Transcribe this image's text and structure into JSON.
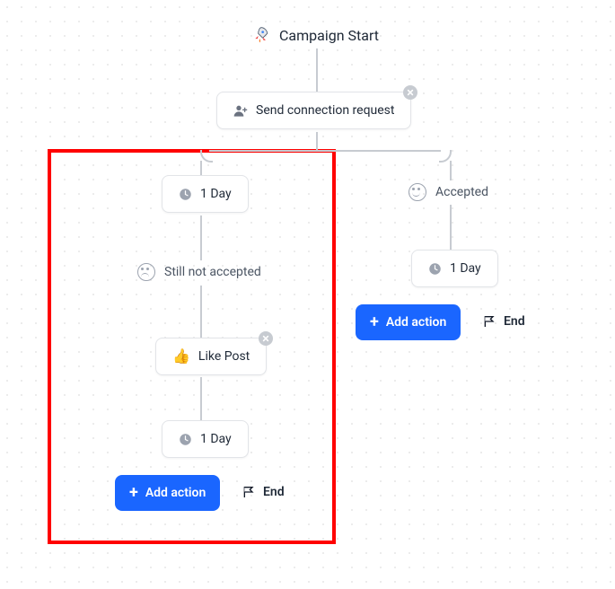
{
  "start": {
    "label": "Campaign Start",
    "icon": "rocket"
  },
  "nodes": {
    "sendRequest": {
      "label": "Send connection request",
      "icon": "add-user",
      "closable": true
    },
    "delayLeft1": {
      "label": "1 Day",
      "icon": "clock"
    },
    "delayLeft2": {
      "label": "1 Day",
      "icon": "clock"
    },
    "delayRight": {
      "label": "1 Day",
      "icon": "clock"
    },
    "likePost": {
      "label": "Like Post",
      "icon": "thumbs-up",
      "closable": true
    }
  },
  "statuses": {
    "notAccepted": {
      "label": "Still not accepted",
      "mood": "frown"
    },
    "accepted": {
      "label": "Accepted",
      "mood": "smile"
    }
  },
  "buttons": {
    "addActionLeft": "Add action",
    "addActionRight": "Add action",
    "endLeft": "End",
    "endRight": "End"
  },
  "colors": {
    "primary": "#1a66ff",
    "line": "#c7cbd1",
    "highlight": "#ff0000"
  }
}
